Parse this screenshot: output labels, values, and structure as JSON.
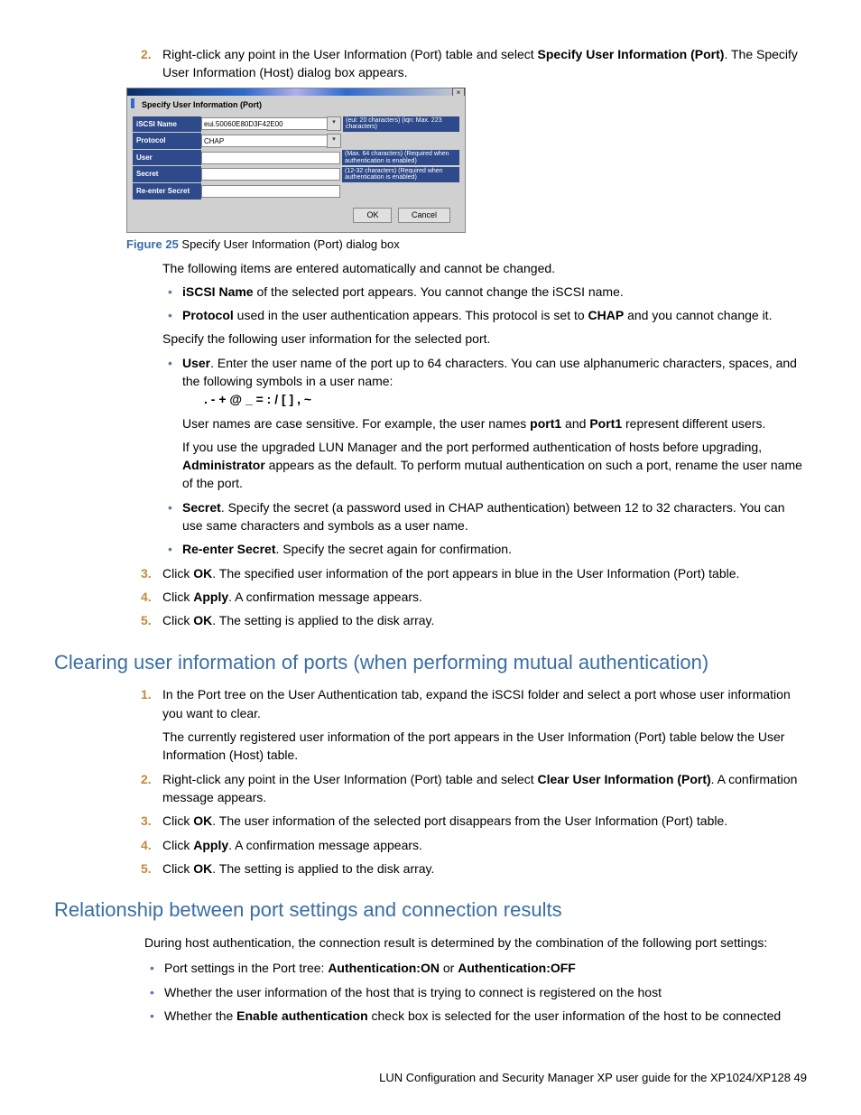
{
  "step2": {
    "text_a": "Right-click any point in the User Information (Port) table and select ",
    "bold": "Specify User Information (Port)",
    "text_b": ". The Specify User Information (Host) dialog box appears."
  },
  "dialog": {
    "title": "Specify User Information (Port)",
    "rows": {
      "iscsi": {
        "label": "iSCSI Name",
        "value": "eui.50060E80D3F42E00",
        "hint": "(eui: 20 characters)\n(iqn: Max. 223 characters)"
      },
      "protocol": {
        "label": "Protocol",
        "value": "CHAP"
      },
      "user": {
        "label": "User",
        "hint": "(Max. 64 characters)\n(Required when authentication is enabled)"
      },
      "secret": {
        "label": "Secret",
        "hint": "(12-32 characters)\n(Required when authentication is enabled)"
      },
      "reenter": {
        "label": "Re-enter Secret"
      }
    },
    "ok": "OK",
    "cancel": "Cancel"
  },
  "figcap": {
    "b": "Figure 25",
    "t": " Specify User Information (Port) dialog box"
  },
  "auto_intro": "The following items are entered automatically and cannot be changed.",
  "auto_items": {
    "i1a": "iSCSI Name",
    "i1b": " of the selected port appears. You cannot change the iSCSI name.",
    "i2a": "Protocol",
    "i2b": " used in the user authentication appears. This protocol is set to ",
    "i2c": "CHAP",
    "i2d": " and you cannot change it."
  },
  "specify_intro": "Specify the following user information for the selected port.",
  "user_item": {
    "b": "User",
    "t": ". Enter the user name of the port up to 64 characters. You can use alphanumeric characters, spaces, and the following symbols in a user name:"
  },
  "symbols": ". - + @ _ = : / [ ] , ~",
  "user_p2a": "User names are case sensitive. For example, the user names ",
  "user_p2b": "port1",
  "user_p2c": " and ",
  "user_p2d": "Port1",
  "user_p2e": " represent different users.",
  "user_p3a": "If you use the upgraded LUN Manager and the port performed authentication of hosts before upgrading, ",
  "user_p3b": "Administrator",
  "user_p3c": " appears as the default. To perform mutual authentication on such a port, rename the user name of the port.",
  "secret_item": {
    "b": "Secret",
    "t": ". Specify the secret (a password used in CHAP authentication) between 12 to 32 characters. You can use same characters and symbols as a user name."
  },
  "reenter_item": {
    "b": "Re-enter Secret",
    "t": ". Specify the secret again for confirmation."
  },
  "step3a": "Click ",
  "step3b": "OK",
  "step3c": ". The specified user information of the port appears in blue in the User Information (Port) table.",
  "step4a": "Click ",
  "step4b": "Apply",
  "step4c": ". A confirmation message appears.",
  "step5a": "Click ",
  "step5b": "OK",
  "step5c": ". The setting is applied to the disk array.",
  "h1": "Clearing user information of ports (when performing mutual authentication)",
  "c1a": "In the Port tree on the User Authentication tab, expand the iSCSI folder and select a port whose user information you want to clear.",
  "c1b": "The currently registered user information of the port appears in the User Information (Port) table below the User Information (Host) table.",
  "c2a": "Right-click any point in the User Information (Port) table and select ",
  "c2b": "Clear User Information (Port)",
  "c2c": ". A confirmation message appears.",
  "c3a": "Click ",
  "c3b": "OK",
  "c3c": ". The user information of the selected port disappears from the User Information (Port) table.",
  "c4a": "Click ",
  "c4b": "Apply",
  "c4c": ". A confirmation message appears.",
  "c5a": "Click ",
  "c5b": "OK",
  "c5c": ". The setting is applied to the disk array.",
  "h2": "Relationship between port settings and connection results",
  "r_intro": "During host authentication, the connection result is determined by the combination of the following port settings:",
  "r1a": "Port settings in the Port tree: ",
  "r1b": "Authentication:ON",
  "r1c": " or ",
  "r1d": "Authentication:OFF",
  "r2": "Whether the user information of the host that is trying to connect is registered on the host",
  "r3a": "Whether the ",
  "r3b": "Enable authentication",
  "r3c": " check box is selected for the user information of the host to be connected",
  "footer": "LUN Configuration and Security Manager XP user guide for the XP1024/XP128    49"
}
